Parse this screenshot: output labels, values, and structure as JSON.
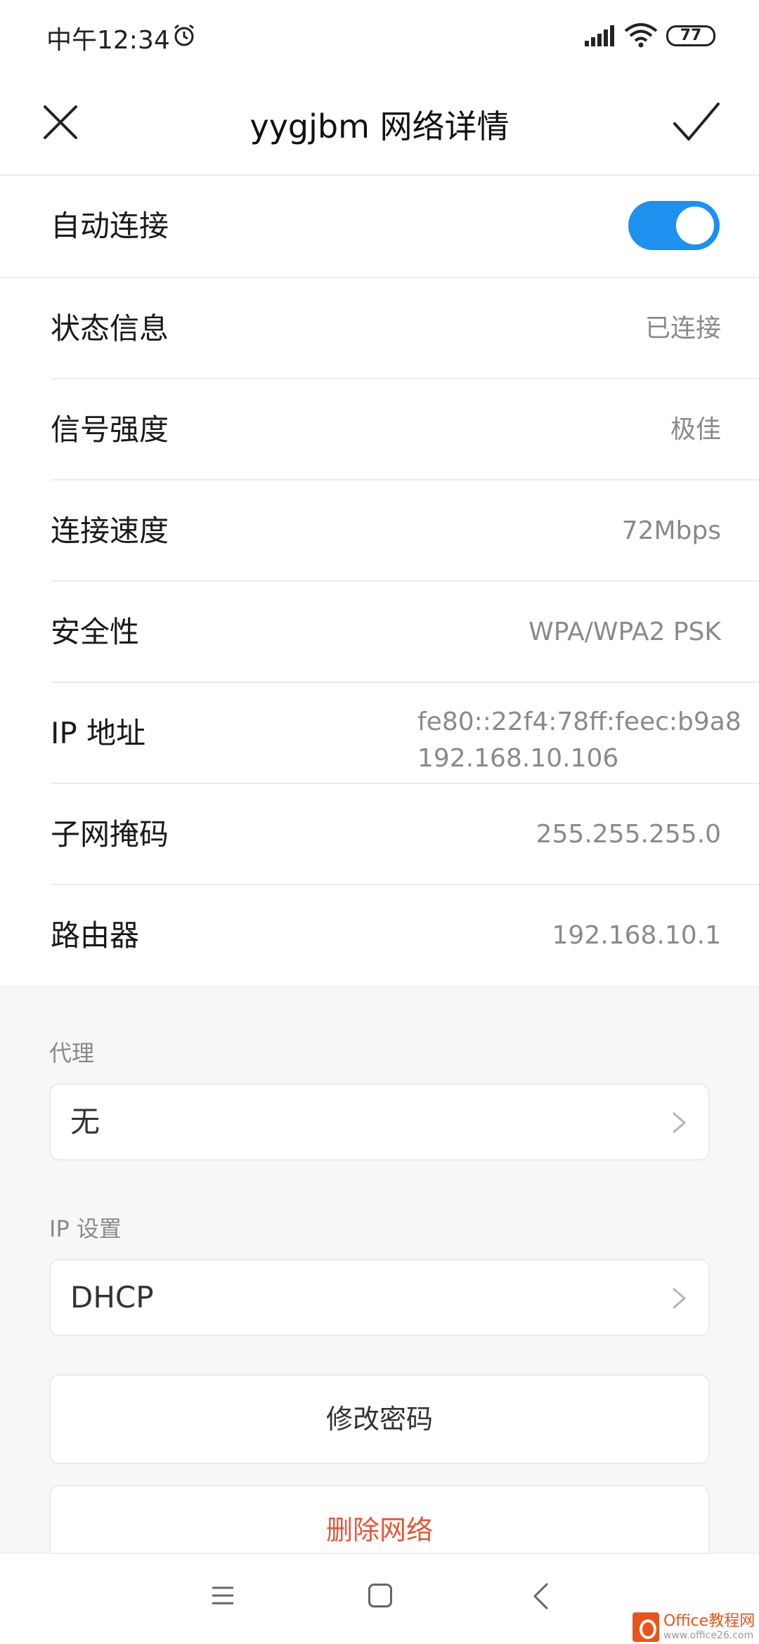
{
  "status_bar": {
    "time": "中午12:34",
    "battery": "77"
  },
  "title_bar": {
    "title": "yygjbm  网络详情"
  },
  "auto_connect": {
    "label": "自动连接",
    "enabled": true
  },
  "details": [
    {
      "label": "状态信息",
      "value": "已连接"
    },
    {
      "label": "信号强度",
      "value": "极佳"
    },
    {
      "label": "连接速度",
      "value": "72Mbps"
    },
    {
      "label": "安全性",
      "value": "WPA/WPA2 PSK"
    },
    {
      "label": "IP 地址",
      "value": "fe80::22f4:78ff:feec:b9a8",
      "value2": "192.168.10.106"
    },
    {
      "label": "子网掩码",
      "value": "255.255.255.0"
    },
    {
      "label": "路由器",
      "value": "192.168.10.1"
    }
  ],
  "proxy": {
    "section_label": "代理",
    "value": "无"
  },
  "ip_settings": {
    "section_label": "IP 设置",
    "value": "DHCP"
  },
  "actions": {
    "change_password": "修改密码",
    "delete_network": "删除网络"
  },
  "watermark": {
    "brand": "Office教程网",
    "url": "www.office26.com"
  },
  "colors": {
    "toggle_on": "#1e90ee",
    "danger": "#e2583a"
  }
}
